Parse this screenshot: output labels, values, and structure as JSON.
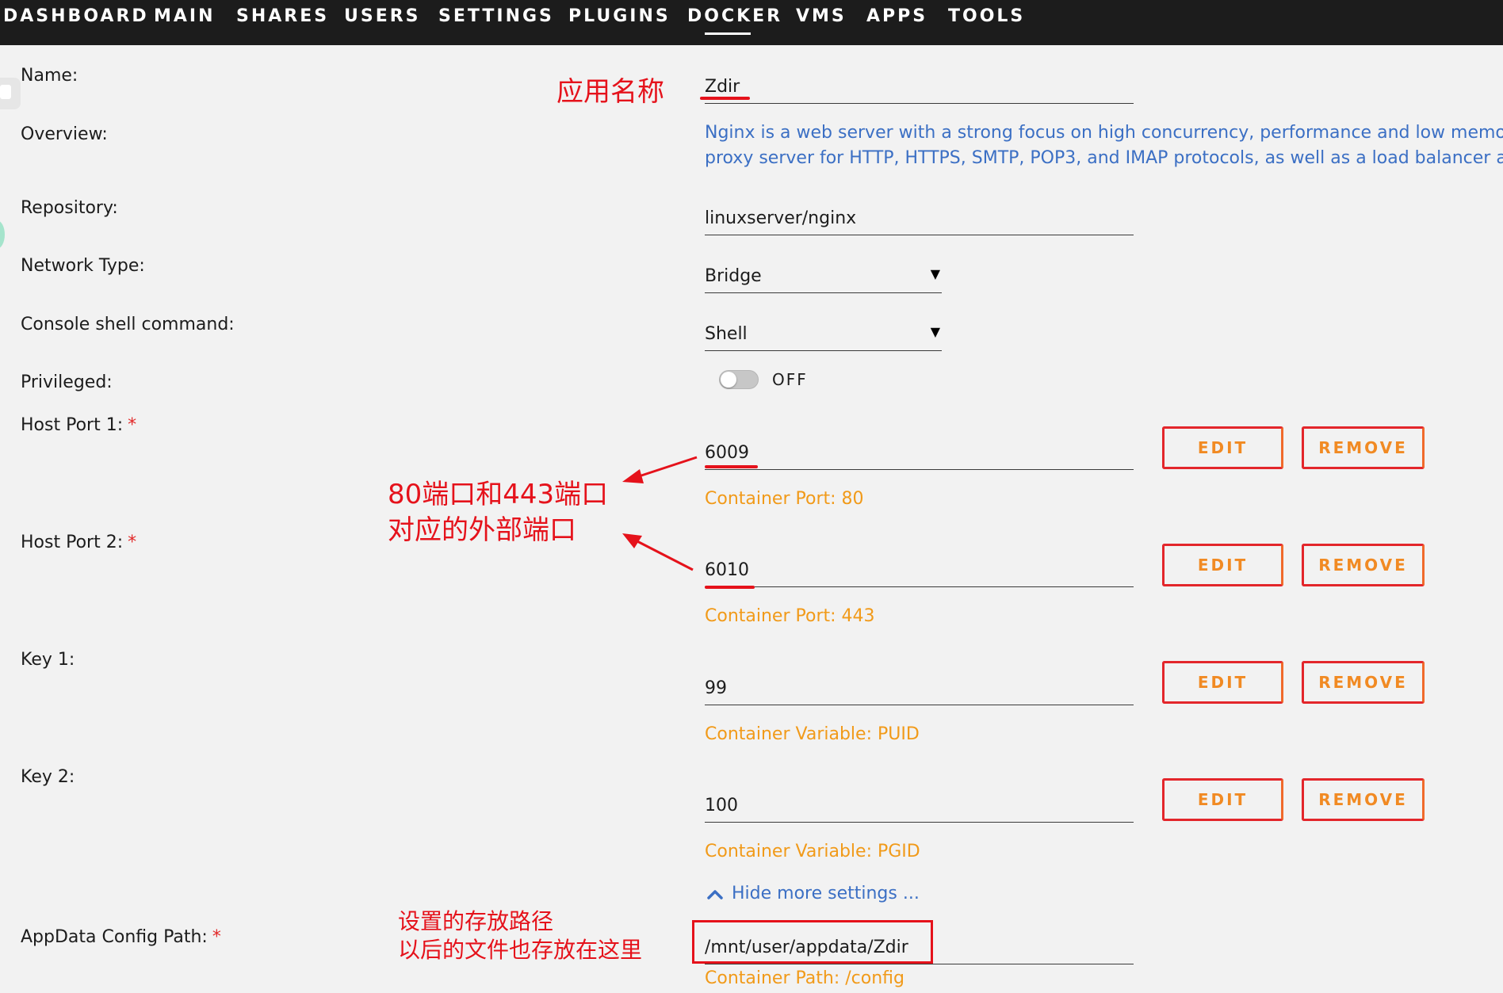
{
  "nav": {
    "items": [
      "DASHBOARD",
      "MAIN",
      "SHARES",
      "USERS",
      "SETTINGS",
      "PLUGINS",
      "DOCKER",
      "VMS",
      "APPS",
      "TOOLS"
    ],
    "active": "DOCKER"
  },
  "form": {
    "name": {
      "label": "Name:",
      "value": "Zdir"
    },
    "overview": {
      "label": "Overview:",
      "line1": "Nginx is a web server with a strong focus on high concurrency, performance and low memory us",
      "line2": "proxy server for HTTP, HTTPS, SMTP, POP3, and IMAP protocols, as well as a load balancer and a"
    },
    "repository": {
      "label": "Repository:",
      "value": "linuxserver/nginx"
    },
    "network_type": {
      "label": "Network Type:",
      "value": "Bridge"
    },
    "console_shell": {
      "label": "Console shell command:",
      "value": "Shell"
    },
    "privileged": {
      "label": "Privileged:",
      "state": "OFF"
    },
    "host_port_1": {
      "label": "Host Port 1:",
      "required": "*",
      "value": "6009",
      "hint": "Container Port: 80"
    },
    "host_port_2": {
      "label": "Host Port 2:",
      "required": "*",
      "value": "6010",
      "hint": "Container Port: 443"
    },
    "key_1": {
      "label": "Key 1:",
      "value": "99",
      "hint": "Container Variable: PUID"
    },
    "key_2": {
      "label": "Key 2:",
      "value": "100",
      "hint": "Container Variable: PGID"
    },
    "hide_more": "Hide more settings ...",
    "appdata": {
      "label": "AppData Config Path:",
      "required": "*",
      "value": "/mnt/user/appdata/Zdir",
      "hint": "Container Path: /config"
    },
    "edit_label": "EDIT",
    "remove_label": "REMOVE"
  },
  "annotations": {
    "app_name": "应用名称",
    "ports_line1": "80端口和443端口",
    "ports_line2": "对应的外部端口",
    "path_line1": "设置的存放路径",
    "path_line2": "以后的文件也存放在这里"
  },
  "colors": {
    "nav_bg": "#1c1c1c",
    "page_bg": "#f2f2f2",
    "link_blue": "#3b6fc4",
    "hint_orange": "#f19a19",
    "button_red": "#e3262b",
    "annotation_red": "#e5121b"
  }
}
